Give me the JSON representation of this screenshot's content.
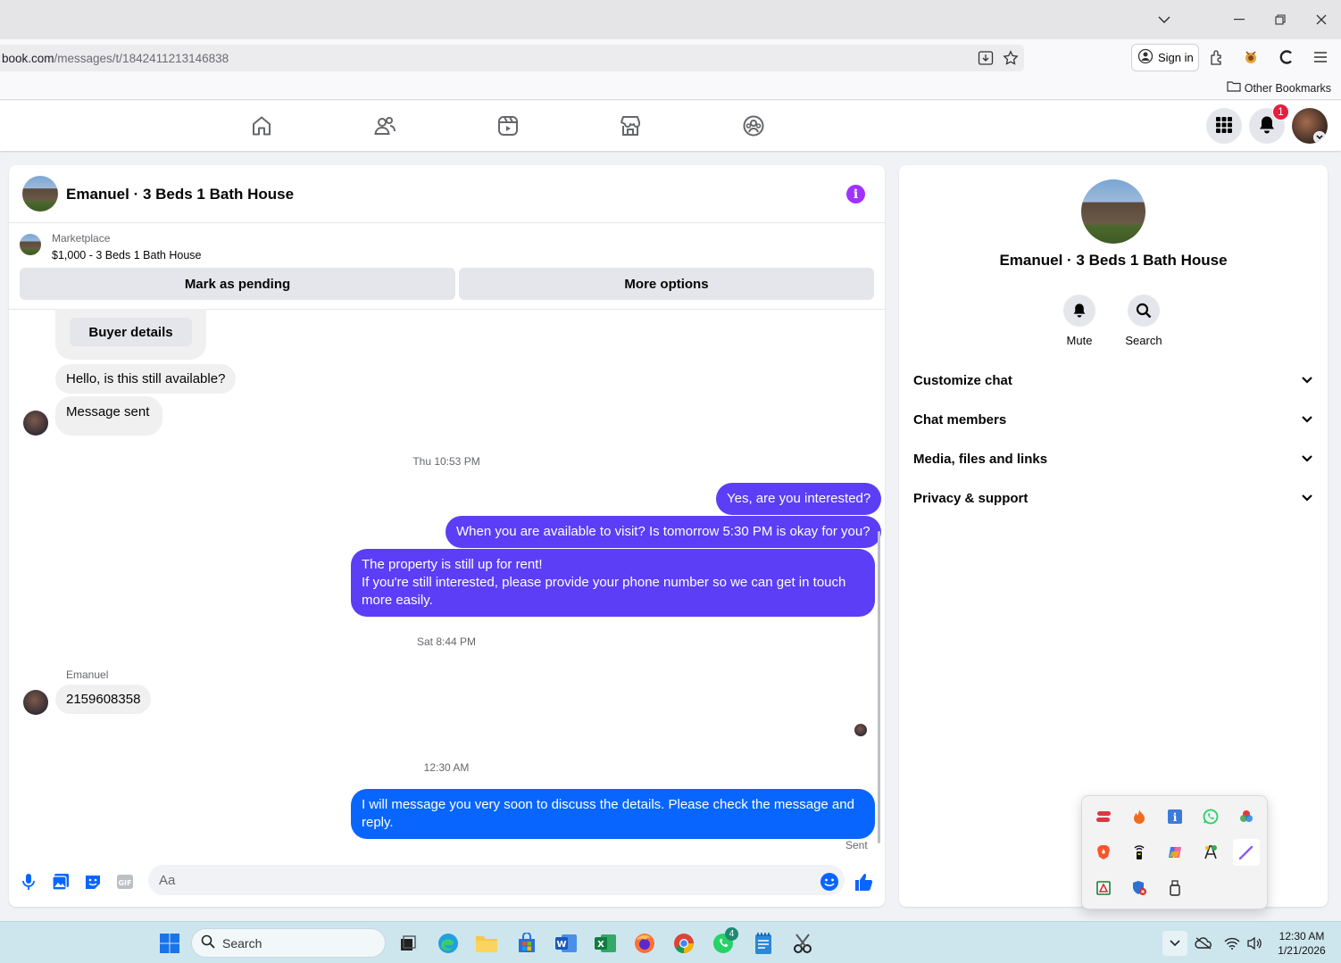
{
  "browser": {
    "url_dim": "book.com",
    "url_path": "/messages/t/1842411213146838",
    "signin_label": "Sign in",
    "other_bookmarks": "Other Bookmarks"
  },
  "header": {
    "notification_count": "1"
  },
  "chat": {
    "title": "Emanuel · 3 Beds 1 Bath House",
    "marketplace_label": "Marketplace",
    "listing": "$1,000 - 3 Beds 1 Bath House",
    "mark_pending": "Mark as pending",
    "more_options": "More options",
    "buyer_details": "Buyer details",
    "messages": {
      "m1": "Hello, is this still available?",
      "m2": "Message sent",
      "ts1": "Thu 10:53 PM",
      "m3": "Yes, are you interested?",
      "m4": "When you are available to visit? Is tomorrow 5:30 PM is okay for you?",
      "m5_line1": "The property is still up for rent!",
      "m5_line2": "If you're still interested, please provide your phone number so we can get in touch more easily.",
      "ts2": "Sat 8:44 PM",
      "sender": "Emanuel",
      "m6": "2159608358",
      "ts3": "12:30 AM",
      "m7": "I will message you very soon to discuss the details. Please check the message and reply.",
      "status": "Sent"
    },
    "composer_placeholder": "Aa"
  },
  "right_panel": {
    "name": "Emanuel · 3 Beds 1 Bath House",
    "mute_label": "Mute",
    "search_label": "Search",
    "sections": [
      "Customize chat",
      "Chat members",
      "Media, files and links",
      "Privacy & support"
    ]
  },
  "taskbar": {
    "search_placeholder": "Search",
    "whatsapp_badge": "4",
    "time": "12:30 AM",
    "date": "1/21/2026"
  },
  "colors": {
    "outgoing_bubble": "#5b3ef5",
    "outgoing_bubble_latest": "#0866ff",
    "accent": "#0866ff",
    "info_icon": "#a033ff",
    "notification_badge": "#e41e3f"
  }
}
